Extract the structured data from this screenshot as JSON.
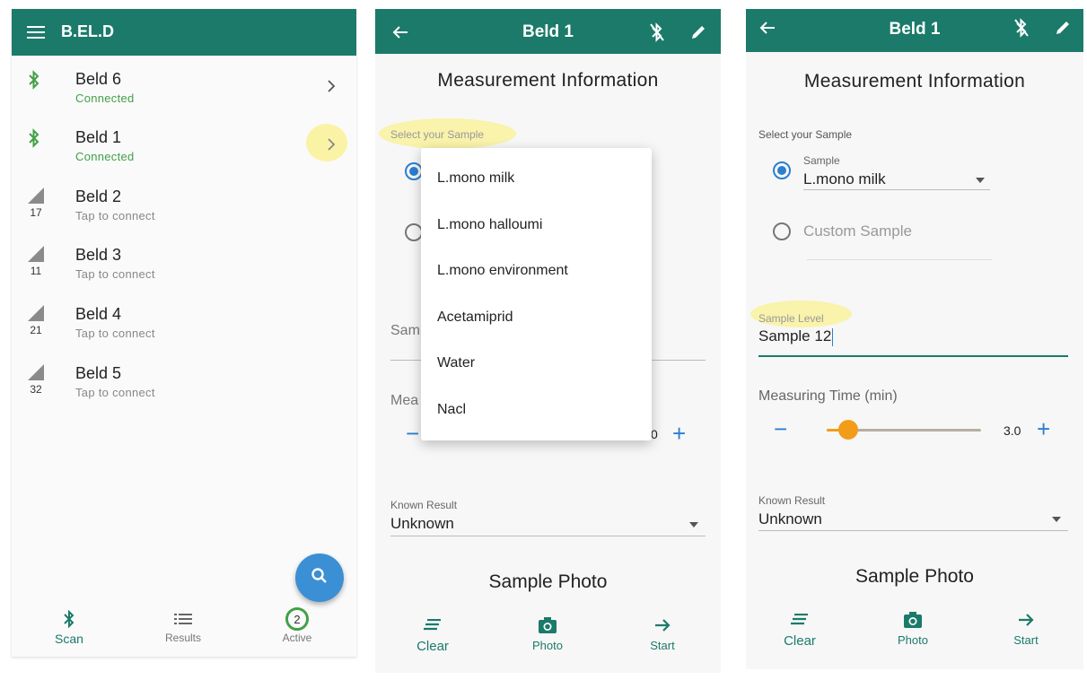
{
  "screen1": {
    "app_title": "B.EL.D",
    "devices": [
      {
        "name": "Beld 6",
        "status": "Connected",
        "signal": ""
      },
      {
        "name": "Beld 1",
        "status": "Connected",
        "signal": ""
      },
      {
        "name": "Beld 2",
        "status": "Tap to connect",
        "signal": "17"
      },
      {
        "name": "Beld 3",
        "status": "Tap to connect",
        "signal": "11"
      },
      {
        "name": "Beld 4",
        "status": "Tap to connect",
        "signal": "21"
      },
      {
        "name": "Beld 5",
        "status": "Tap to connect",
        "signal": "32"
      }
    ],
    "nav": {
      "scan": "Scan",
      "results": "Results",
      "active": "Active",
      "active_count": "2"
    }
  },
  "screen2": {
    "title": "Beld 1",
    "heading": "Measurement Information",
    "select_label": "Select your Sample",
    "sample_partial": "Samp",
    "measuring_partial": "Mea",
    "time_partial": "0",
    "dropdown_options": [
      "L.mono milk",
      "L.mono halloumi",
      "L.mono environment",
      "Acetamiprid",
      "Water",
      "Nacl"
    ],
    "known_result_label": "Known Result",
    "known_result_value": "Unknown",
    "photo_section": "Sample Photo",
    "actions": {
      "clear": "Clear",
      "photo": "Photo",
      "start": "Start"
    }
  },
  "screen3": {
    "title": "Beld 1",
    "heading": "Measurement Information",
    "select_label": "Select your Sample",
    "sample_label": "Sample",
    "sample_value": "L.mono milk",
    "custom_sample": "Custom Sample",
    "sample_level_label": "Sample Level",
    "sample_level_value": "Sample 12",
    "measuring_time_label": "Measuring Time (min)",
    "measuring_time_value": "3.0",
    "slider_fraction": 0.14,
    "known_result_label": "Known Result",
    "known_result_value": "Unknown",
    "photo_section": "Sample Photo",
    "actions": {
      "clear": "Clear",
      "photo": "Photo",
      "start": "Start"
    }
  },
  "colors": {
    "primary": "#1b7a6a",
    "accent": "#2b7fd0",
    "connected": "#43a047",
    "slider": "#f39c19",
    "fab": "#3b8fd4"
  }
}
